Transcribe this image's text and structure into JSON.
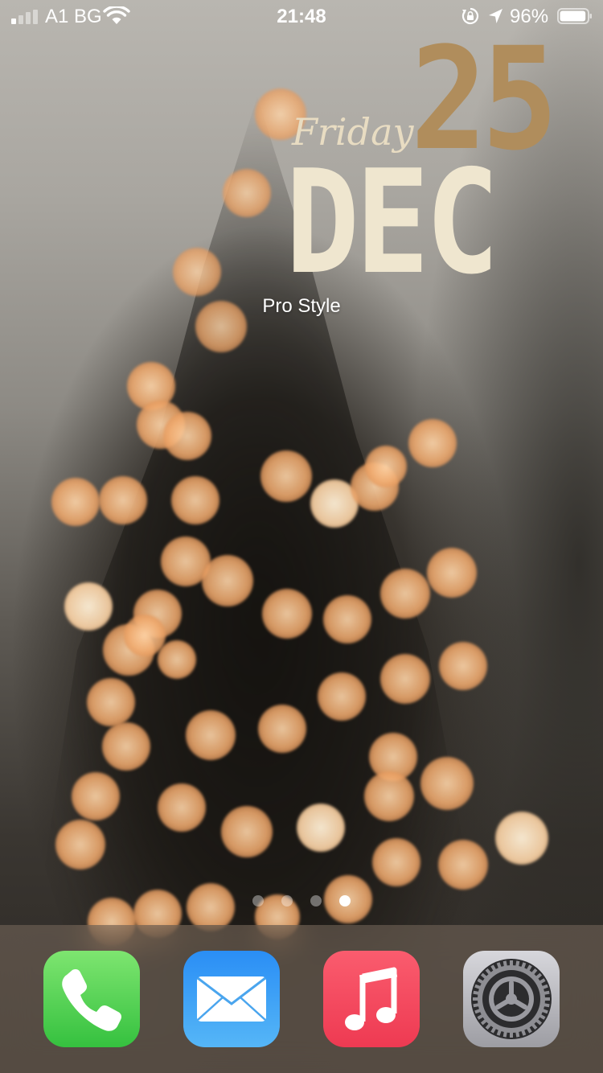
{
  "status_bar": {
    "carrier": "A1 BG",
    "time": "21:48",
    "battery_percent": "96%",
    "signal_bars_filled": 1,
    "signal_bars_total": 4,
    "battery_level": 0.96,
    "icons": [
      "signal-icon",
      "wifi-icon",
      "orientation-lock-icon",
      "location-icon",
      "battery-icon"
    ]
  },
  "widget": {
    "day_number": "25",
    "weekday": "Friday",
    "month": "DEC",
    "label": "Pro Style",
    "colors": {
      "day": "#b08d5c",
      "month": "#efe6cf",
      "weekday": "#e8dcc2"
    }
  },
  "pager": {
    "total": 4,
    "active_index": 3
  },
  "dock": {
    "apps": [
      {
        "name": "Phone",
        "icon": "phone-icon"
      },
      {
        "name": "Mail",
        "icon": "mail-icon"
      },
      {
        "name": "Music",
        "icon": "music-icon"
      },
      {
        "name": "Settings",
        "icon": "settings-gear-icon"
      }
    ]
  }
}
